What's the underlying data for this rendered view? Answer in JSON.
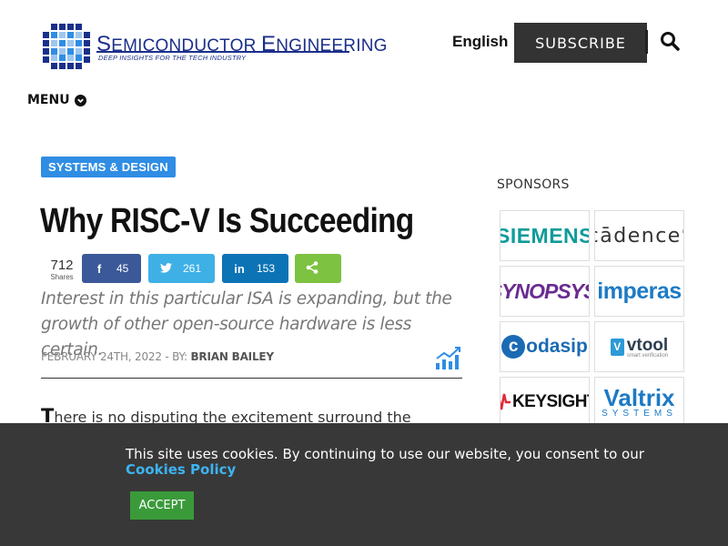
{
  "header": {
    "logo_title_a": "S",
    "logo_title_b": "EMICONDUCTOR ",
    "logo_title_c": "E",
    "logo_title_d": "NGINEERING",
    "logo_tagline": "DEEP INSIGHTS FOR THE TECH INDUSTRY",
    "language_flag": "",
    "language": "English",
    "subscribe_label": "SUBSCRIBE",
    "menu_label": "MENU"
  },
  "article": {
    "category": "SYSTEMS & DESIGN",
    "title": "Why RISC-V Is Succeeding",
    "share_count": "712",
    "share_count_label": "Shares",
    "facebook_count": "45",
    "twitter_count": "261",
    "linkedin_count": "153",
    "subtitle": "Interest in this particular ISA is expanding, but the growth of other open-source hardware is less certain.",
    "date": "FEBRUARY 24TH, 2022 - BY: ",
    "author": "BRIAN BAILEY",
    "dropcap": "T",
    "body_start": "here is no disputing the excitement surround the"
  },
  "sponsors": {
    "heading": "SPONSORS",
    "items": [
      "SIEMENS",
      "cādence",
      "SYNOPSYS",
      "imperas",
      "odasip",
      "vtool",
      "KEYSIGHT",
      "Valtrix"
    ],
    "codasip_prefix": "c",
    "vtool_badge": "V",
    "vtool_sub": "smart verification",
    "cadence_reg": "®",
    "synopsys_reg": "®",
    "valtrix_sub": "SYSTEMS"
  },
  "cookie": {
    "message": "This site uses cookies. By continuing to use our website, you consent to our",
    "policy_link": "Cookies Policy",
    "accept_label": "ACCEPT"
  },
  "colors": {
    "brand": "#1b2f8a",
    "category": "#2f8de4",
    "facebook": "#3b5998",
    "twitter": "#3eb0e6",
    "linkedin": "#0c73b5",
    "share": "#7dc241",
    "cookie_bg": "#383838",
    "accept": "#3a9a3a"
  }
}
